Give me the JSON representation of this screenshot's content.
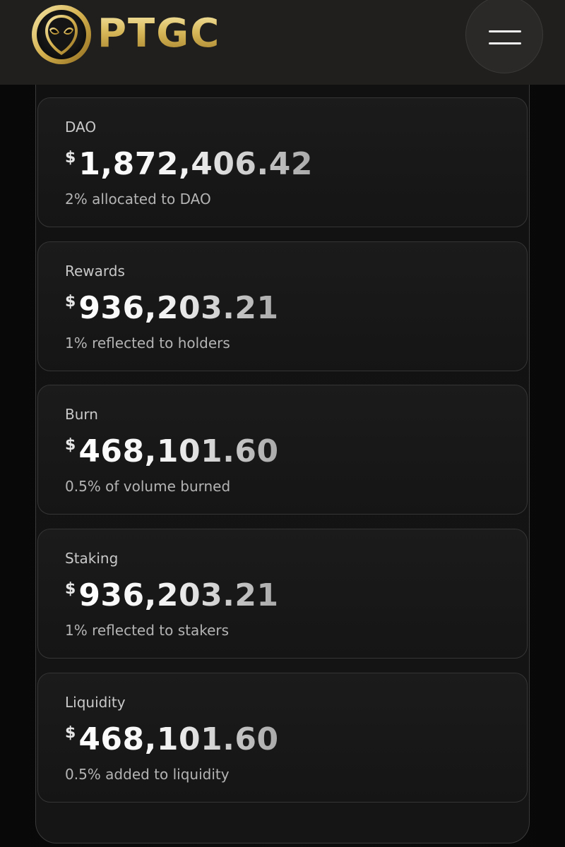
{
  "header": {
    "logo_text": "PTGC",
    "logo_icon": "alien-head-icon",
    "menu_icon": "hamburger-menu-icon"
  },
  "colors": {
    "background": "#0b0b0b",
    "header": "#201f1e",
    "card": "#1b1b1b",
    "gold_light": "#f3e3a0",
    "gold_dark": "#a8822a"
  },
  "cards": [
    {
      "label": "DAO",
      "currency": "$",
      "value": "1,872,406.42",
      "description": "2% allocated to DAO"
    },
    {
      "label": "Rewards",
      "currency": "$",
      "value": "936,203.21",
      "description": "1% reflected to holders"
    },
    {
      "label": "Burn",
      "currency": "$",
      "value": "468,101.60",
      "description": "0.5% of volume burned"
    },
    {
      "label": "Staking",
      "currency": "$",
      "value": "936,203.21",
      "description": "1% reflected to stakers"
    },
    {
      "label": "Liquidity",
      "currency": "$",
      "value": "468,101.60",
      "description": "0.5% added to liquidity"
    }
  ]
}
